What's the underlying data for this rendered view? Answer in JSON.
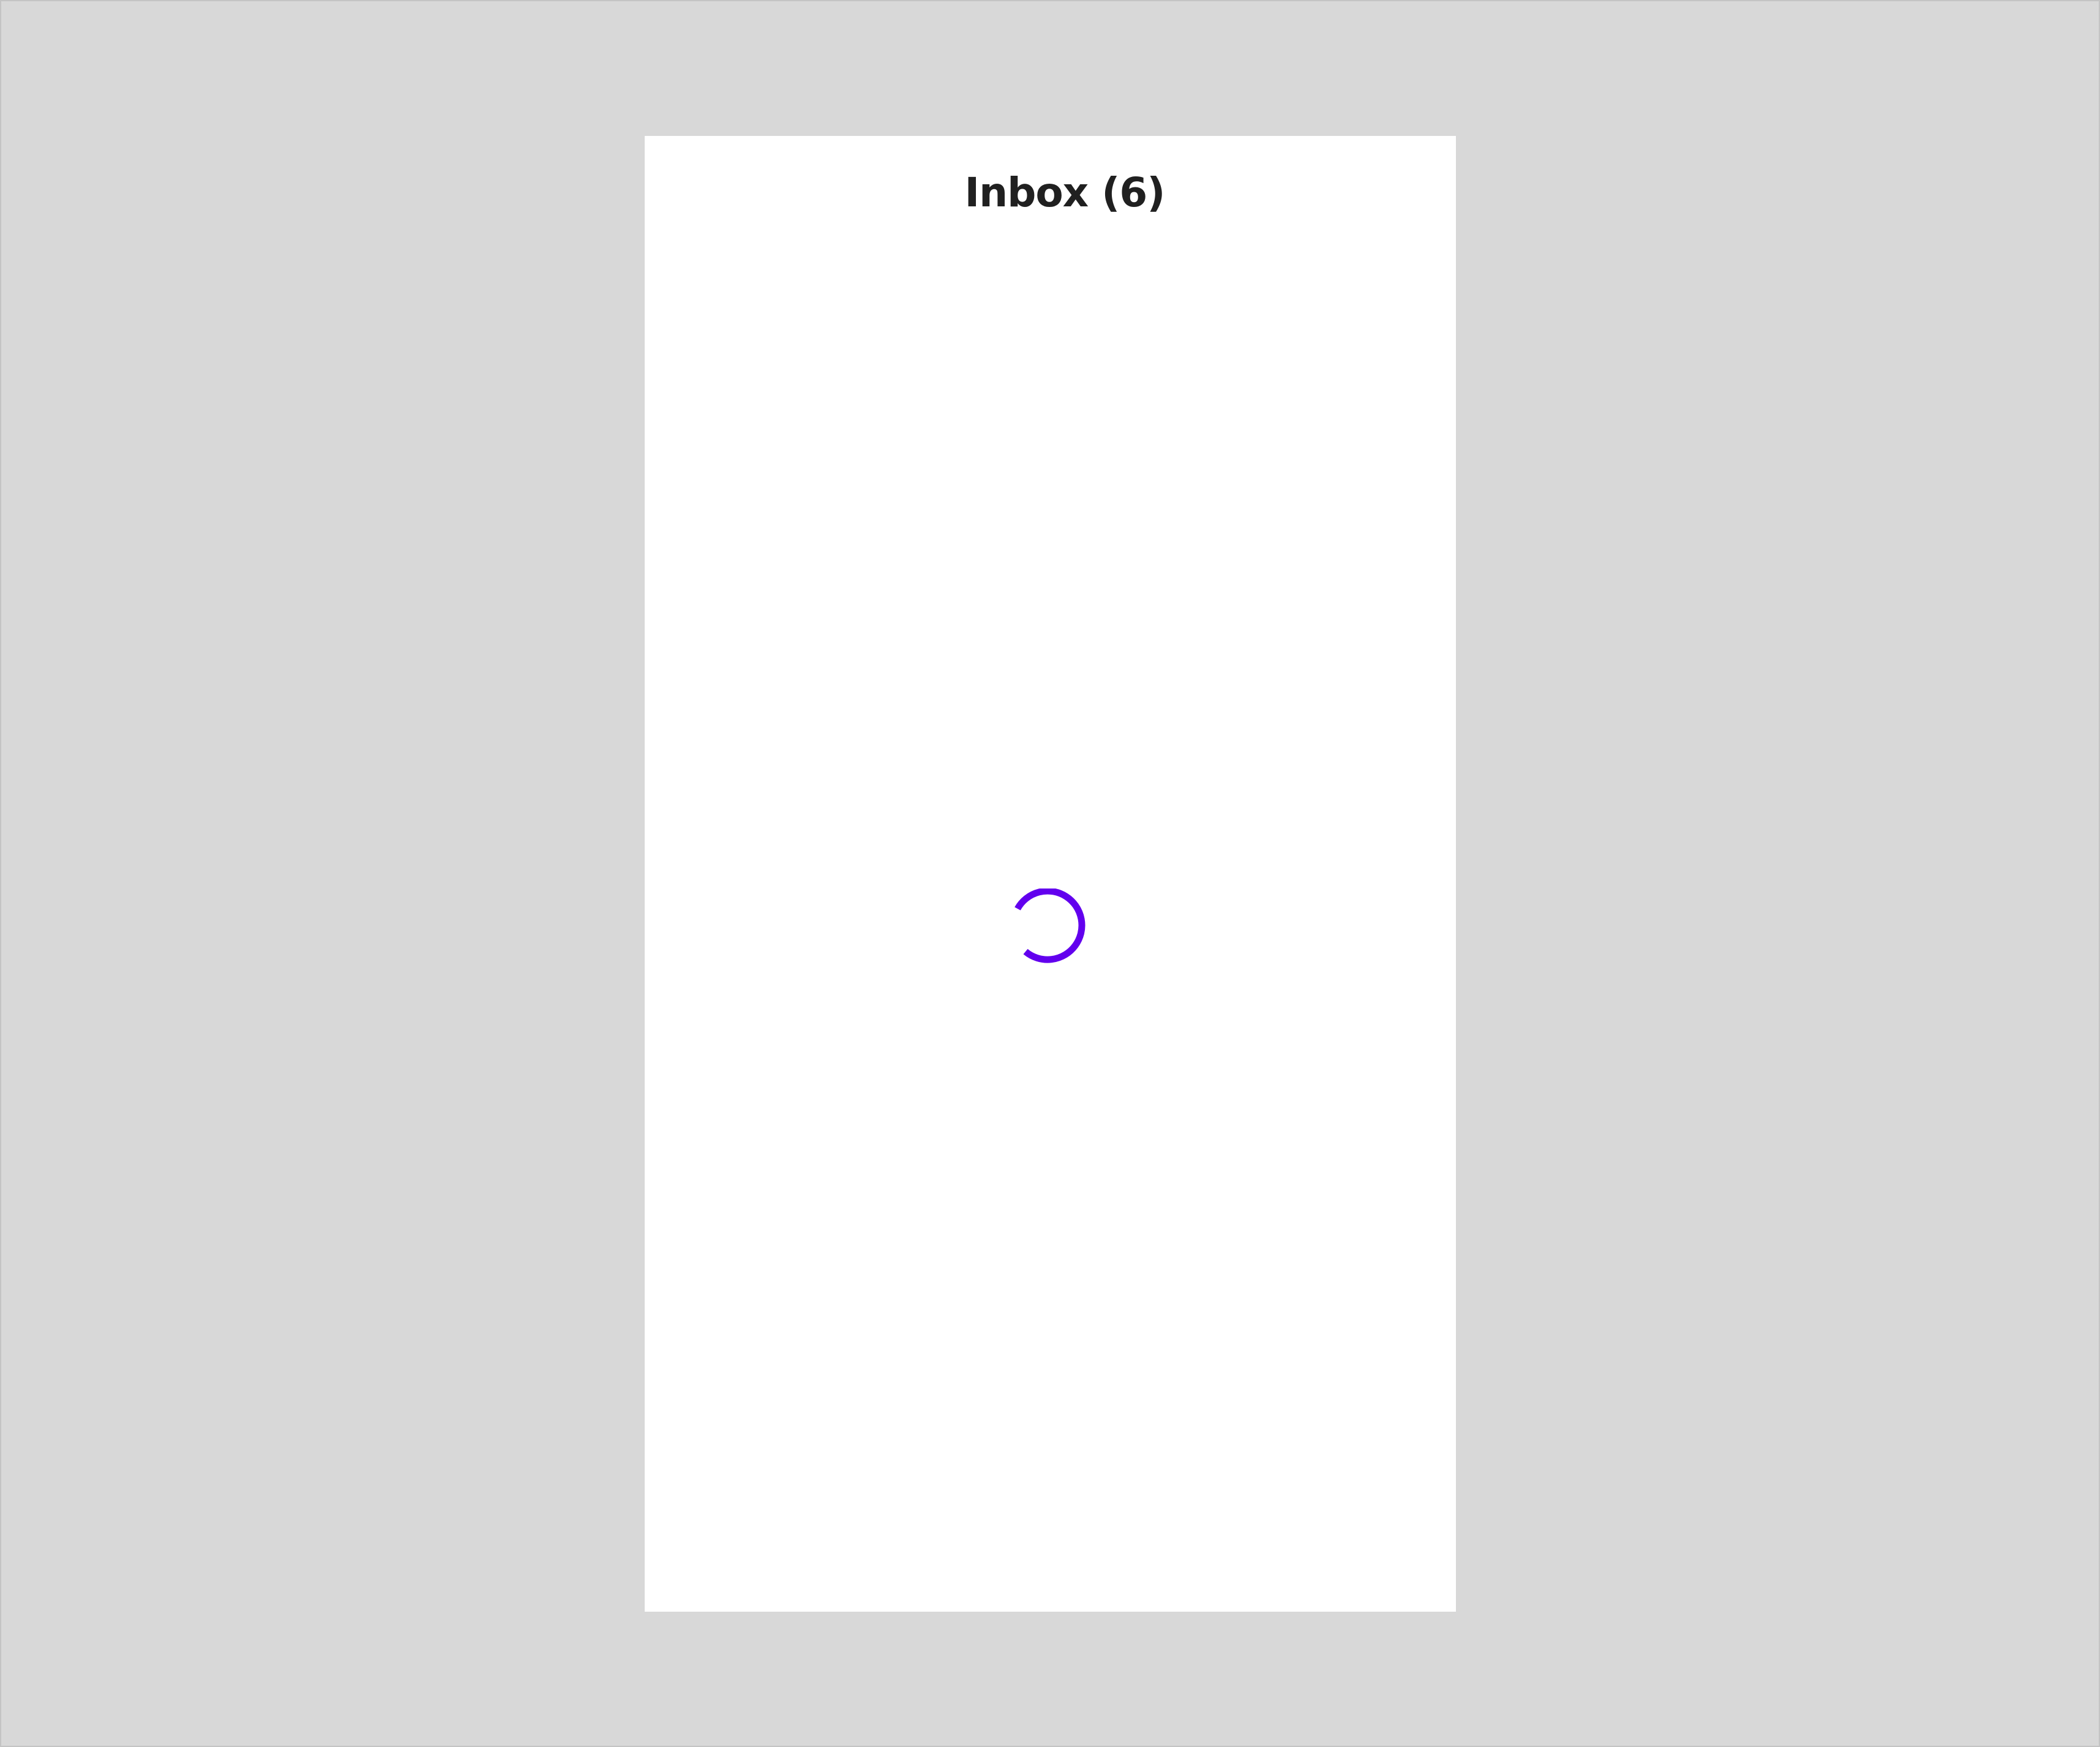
{
  "screen": {
    "title": "Inbox (6)"
  },
  "loading_indicator": {
    "icon": "loading-spinner-icon",
    "color": "#6200ee"
  },
  "colors": {
    "backdrop": "#d8d8d8",
    "screen_background": "#ffffff",
    "title_text": "#202020",
    "accent": "#6200ee"
  }
}
